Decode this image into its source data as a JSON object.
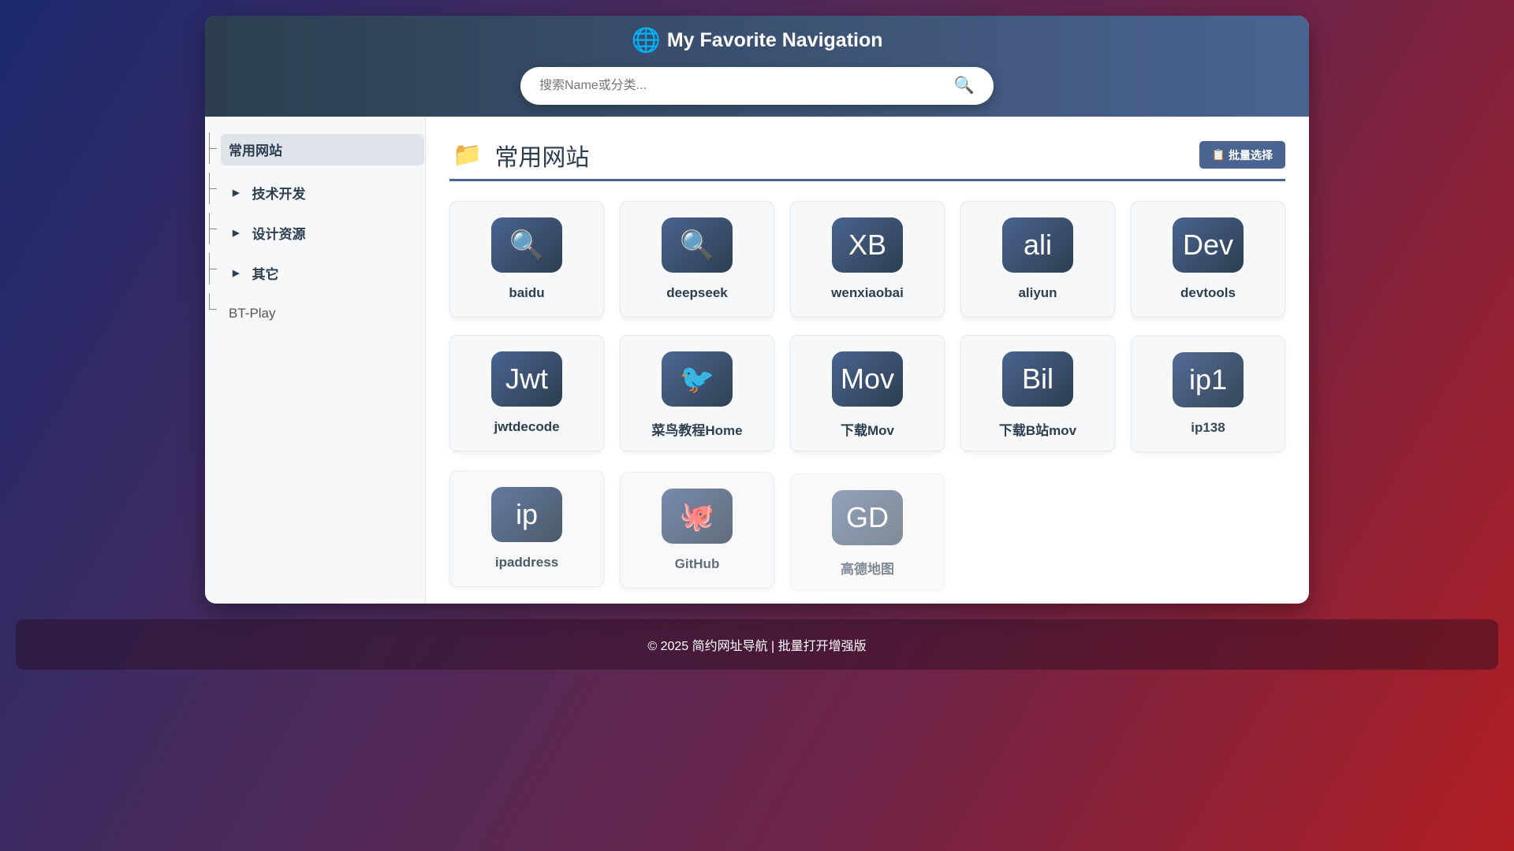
{
  "header": {
    "title": "My Favorite Navigation",
    "search_placeholder": "搜索Name或分类..."
  },
  "sidebar": {
    "items": [
      {
        "label": "常用网站",
        "active": true
      },
      {
        "label": "技术开发",
        "collapsible": true
      },
      {
        "label": "设计资源",
        "collapsible": true
      },
      {
        "label": "其它",
        "collapsible": true
      },
      {
        "label": "BT-Play"
      }
    ]
  },
  "main": {
    "title": "常用网站",
    "batch_label": "批量选择",
    "sites": [
      {
        "icon": "🔍",
        "name": "baidu"
      },
      {
        "icon": "🔍",
        "name": "deepseek"
      },
      {
        "icon": "XB",
        "name": "wenxiaobai"
      },
      {
        "icon": "ali",
        "name": "aliyun"
      },
      {
        "icon": "Dev",
        "name": "devtools"
      },
      {
        "icon": "Jwt",
        "name": "jwtdecode"
      },
      {
        "icon": "🐦",
        "name": "菜鸟教程Home"
      },
      {
        "icon": "Mov",
        "name": "下载Mov"
      },
      {
        "icon": "Bil",
        "name": "下载B站mov"
      },
      {
        "icon": "ip1",
        "name": "ip138"
      },
      {
        "icon": "ip",
        "name": "ipaddress"
      },
      {
        "icon": "🐙",
        "name": "GitHub"
      },
      {
        "icon": "GD",
        "name": "高德地图"
      }
    ]
  },
  "footer": {
    "text": "© 2025 简约网址导航 | 批量打开增强版"
  },
  "colors": {
    "primary": "#4a6491",
    "dark": "#2c3e50"
  }
}
